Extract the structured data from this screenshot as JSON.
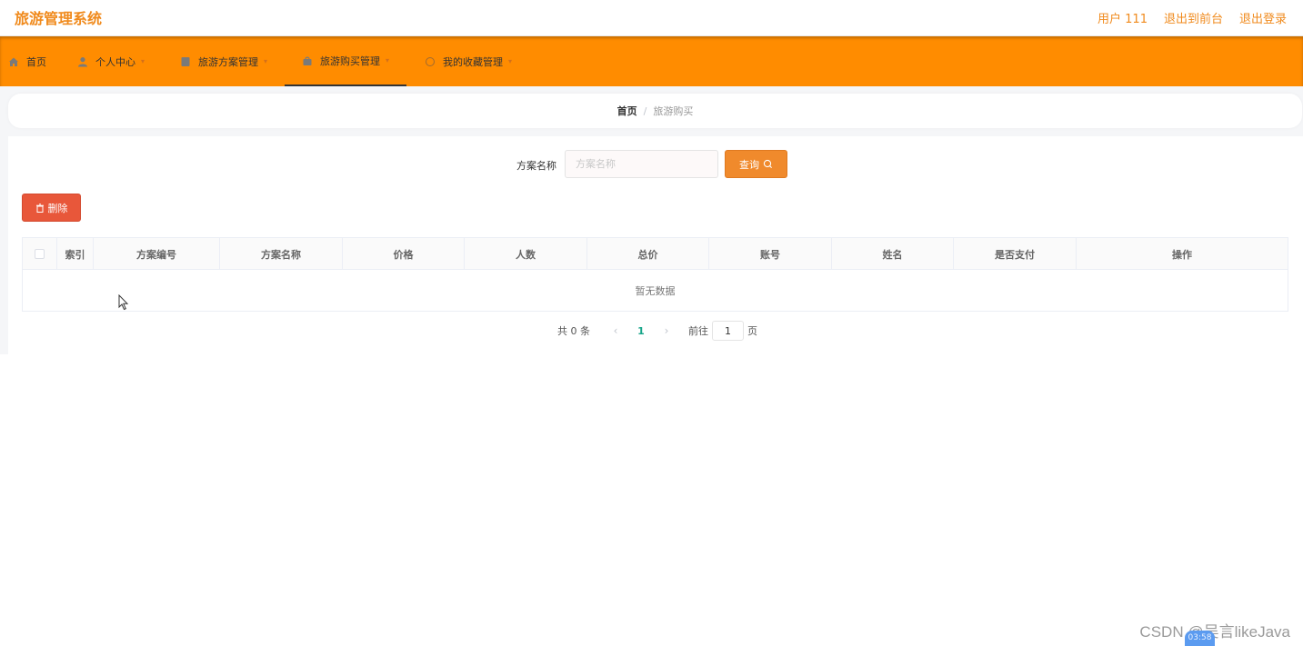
{
  "header": {
    "app_title": "旅游管理系统",
    "user_label": "用户 111",
    "to_frontend": "退出到前台",
    "logout": "退出登录"
  },
  "nav": {
    "items": [
      {
        "label": "首页",
        "icon": "home-icon"
      },
      {
        "label": "个人中心",
        "icon": "user-icon"
      },
      {
        "label": "旅游方案管理",
        "icon": "document-icon"
      },
      {
        "label": "旅游购买管理",
        "icon": "bag-icon"
      },
      {
        "label": "我的收藏管理",
        "icon": "star-icon"
      }
    ],
    "active_index": 3,
    "accent": "#ff8c00"
  },
  "breadcrumb": {
    "home": "首页",
    "separator": "/",
    "current": "旅游购买"
  },
  "search": {
    "label": "方案名称",
    "placeholder": "方案名称",
    "query_button": "查询"
  },
  "actions": {
    "delete_button": "删除"
  },
  "table": {
    "columns": [
      "索引",
      "方案编号",
      "方案名称",
      "价格",
      "人数",
      "总价",
      "账号",
      "姓名",
      "是否支付",
      "操作"
    ],
    "empty_text": "暂无数据"
  },
  "pagination": {
    "total": "共 0 条",
    "current_page": "1",
    "goto_label": "前往",
    "goto_value": "1",
    "page_suffix": "页"
  },
  "watermark": "CSDN @吴言likeJava",
  "timer": "03:58"
}
